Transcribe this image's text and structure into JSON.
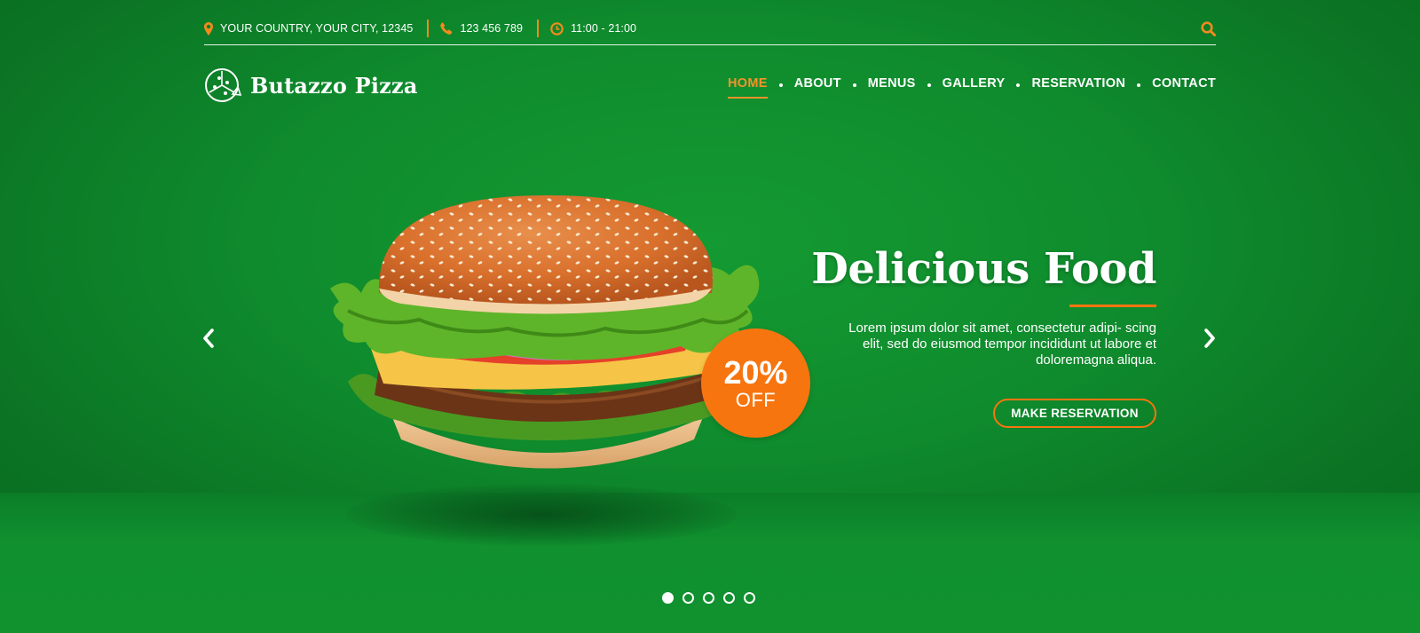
{
  "colors": {
    "accent": "#f6922a",
    "badge": "#f7750f",
    "background": "#0f8b2d"
  },
  "topbar": {
    "address": "YOUR COUNTRY, YOUR CITY, 12345",
    "address_icon": "map-pin-icon",
    "phone": "123 456 789",
    "phone_icon": "phone-icon",
    "hours": "11:00 - 21:00",
    "hours_icon": "clock-icon",
    "search_icon": "search-icon"
  },
  "brand": {
    "name": "Butazzo Pizza",
    "logo_icon": "pizza-logo-icon"
  },
  "nav": {
    "items": [
      "HOME",
      "ABOUT",
      "MENUS",
      "GALLERY",
      "RESERVATION",
      "CONTACT"
    ],
    "active": "HOME"
  },
  "hero": {
    "title": "Delicious Food",
    "description": "Lorem ipsum dolor sit amet, consectetur adipi- scing elit, sed do eiusmod tempor incididunt ut labore et doloremagna aliqua.",
    "cta_label": "MAKE RESERVATION",
    "badge_percent": "20%",
    "badge_label": "OFF",
    "image_icon": "burger-image",
    "prev_icon": "chevron-left-icon",
    "next_icon": "chevron-right-icon"
  },
  "slider": {
    "total": 5,
    "active_index": 0
  }
}
